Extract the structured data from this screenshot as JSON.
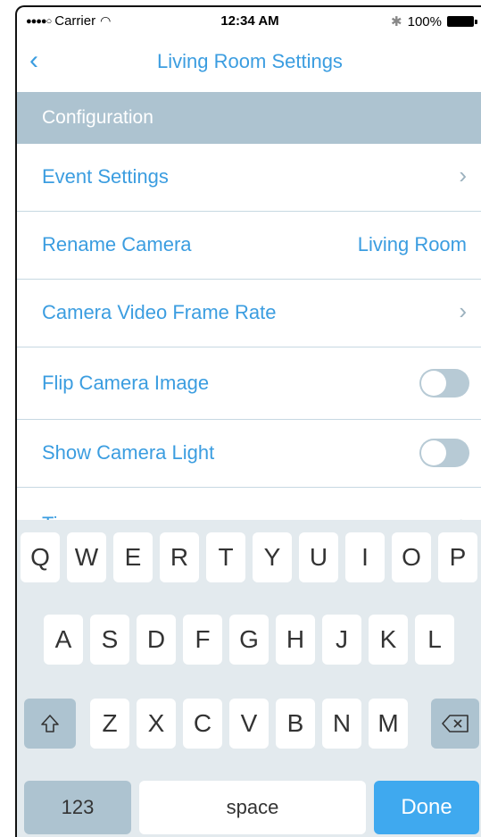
{
  "status": {
    "carrier": "Carrier",
    "time": "12:34 AM",
    "battery": "100%"
  },
  "nav": {
    "title": "Living Room Settings",
    "back_icon": "chevron-left-icon"
  },
  "section": {
    "title": "Configuration"
  },
  "rows": [
    {
      "label": "Event Settings",
      "type": "chevron"
    },
    {
      "label": "Rename Camera",
      "type": "value",
      "value": "Living Room"
    },
    {
      "label": "Camera Video Frame Rate",
      "type": "chevron"
    },
    {
      "label": "Flip Camera Image",
      "type": "toggle",
      "on": false
    },
    {
      "label": "Show Camera Light",
      "type": "toggle",
      "on": false
    },
    {
      "label": "Time",
      "type": "chevron"
    }
  ],
  "keyboard": {
    "row1": [
      "Q",
      "W",
      "E",
      "R",
      "T",
      "Y",
      "U",
      "I",
      "O",
      "P"
    ],
    "row2": [
      "A",
      "S",
      "D",
      "F",
      "G",
      "H",
      "J",
      "K",
      "L"
    ],
    "row3": [
      "Z",
      "X",
      "C",
      "V",
      "B",
      "N",
      "M"
    ],
    "numbers_label": "123",
    "space_label": "space",
    "done_label": "Done"
  },
  "colors": {
    "accent": "#3b9de0",
    "section_bg": "#adc3d0",
    "keyboard_bg": "#e3eaee",
    "done_bg": "#3fa9ef"
  }
}
